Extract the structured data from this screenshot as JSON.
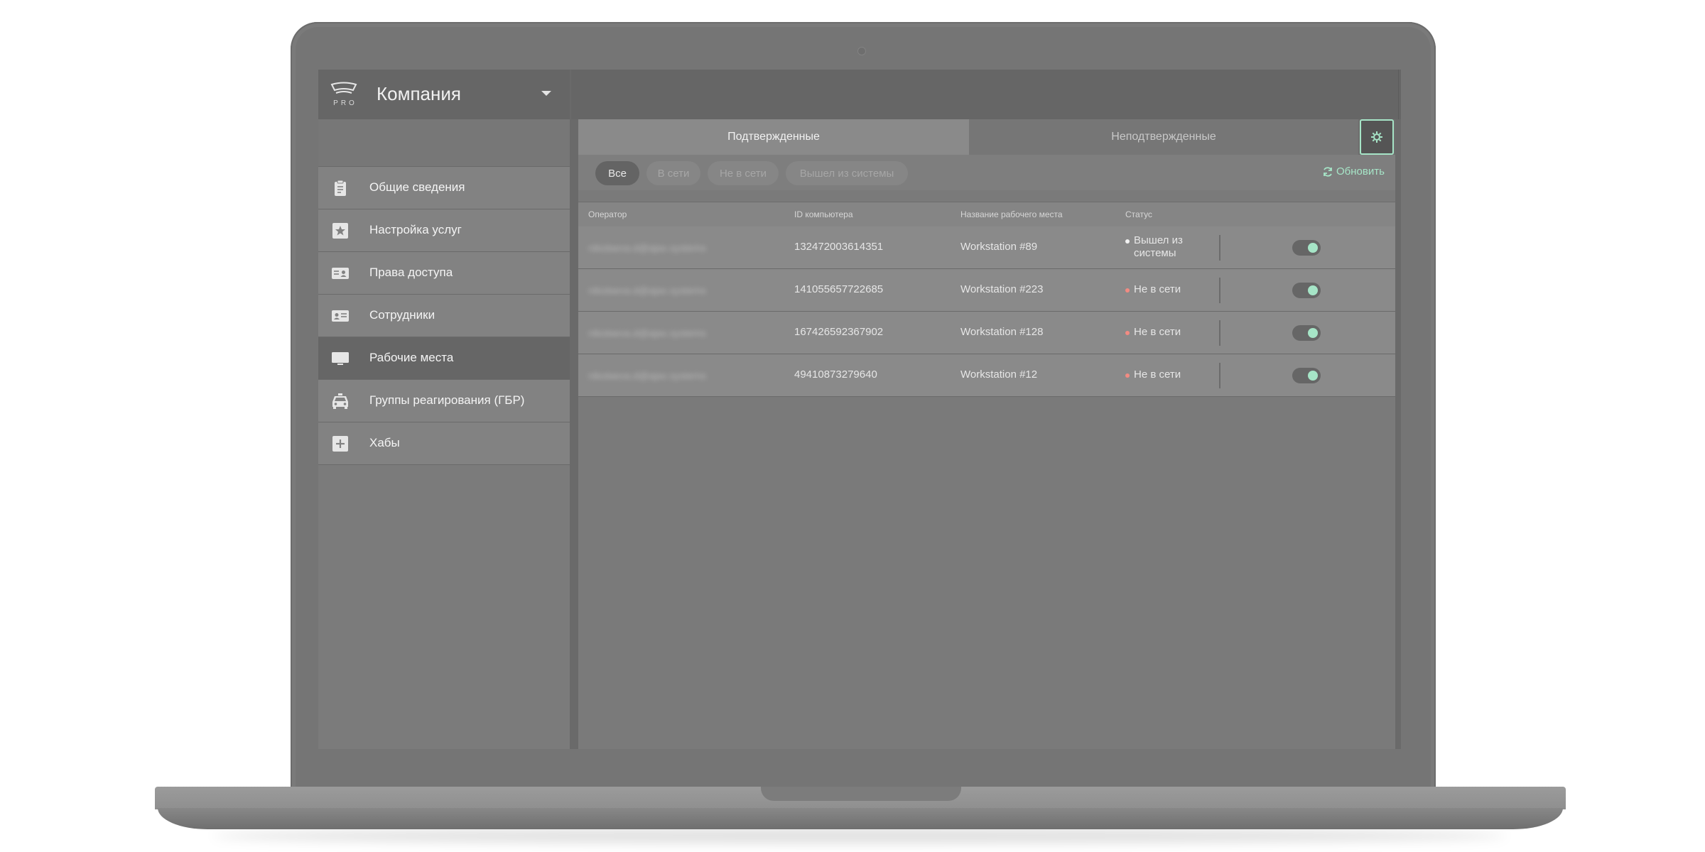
{
  "brand": {
    "logo_text": "PRO",
    "company": "Компания"
  },
  "sidebar": {
    "items": [
      {
        "label": "Общие сведения",
        "icon": "clipboard-icon"
      },
      {
        "label": "Настройка услуг",
        "icon": "star-icon"
      },
      {
        "label": "Права доступа",
        "icon": "id-card-icon"
      },
      {
        "label": "Сотрудники",
        "icon": "contact-card-icon"
      },
      {
        "label": "Рабочие места",
        "icon": "monitor-icon",
        "active": true
      },
      {
        "label": "Группы реагирования (ГБР)",
        "icon": "car-icon"
      },
      {
        "label": "Хабы",
        "icon": "plus-square-icon"
      }
    ]
  },
  "tabs": {
    "confirmed": "Подтвержденные",
    "unconfirmed": "Неподтвержденные"
  },
  "filters": {
    "all": "Все",
    "online": "В сети",
    "offline": "Не в сети",
    "logged_out": "Вышел из системы",
    "refresh": "Обновить"
  },
  "table": {
    "headers": {
      "operator": "Оператор",
      "computer_id": "ID компьютера",
      "workstation": "Название рабочего места",
      "status": "Статус"
    },
    "rows": [
      {
        "operator": "nikolaeva.d@ajax.systems",
        "computer_id": "132472003614351",
        "workstation": "Workstation #89",
        "status_line1": "Вышел из",
        "status_line2": "системы",
        "status_color": "#f2f2f2",
        "enabled": true
      },
      {
        "operator": "nikolaeva.d@ajax.systems",
        "computer_id": "141055657722685",
        "workstation": "Workstation #223",
        "status_line1": "Не в сети",
        "status_line2": "",
        "status_color": "#f28b82",
        "enabled": true
      },
      {
        "operator": "nikolaeva.d@ajax.systems",
        "computer_id": "167426592367902",
        "workstation": "Workstation #128",
        "status_line1": "Не в сети",
        "status_line2": "",
        "status_color": "#f28b82",
        "enabled": true
      },
      {
        "operator": "nikolaeva.d@ajax.systems",
        "computer_id": "49410873279640",
        "workstation": "Workstation #12",
        "status_line1": "Не в сети",
        "status_line2": "",
        "status_color": "#f28b82",
        "enabled": true
      }
    ]
  },
  "colors": {
    "accent": "#a6e5c7",
    "offline": "#f28b82"
  }
}
